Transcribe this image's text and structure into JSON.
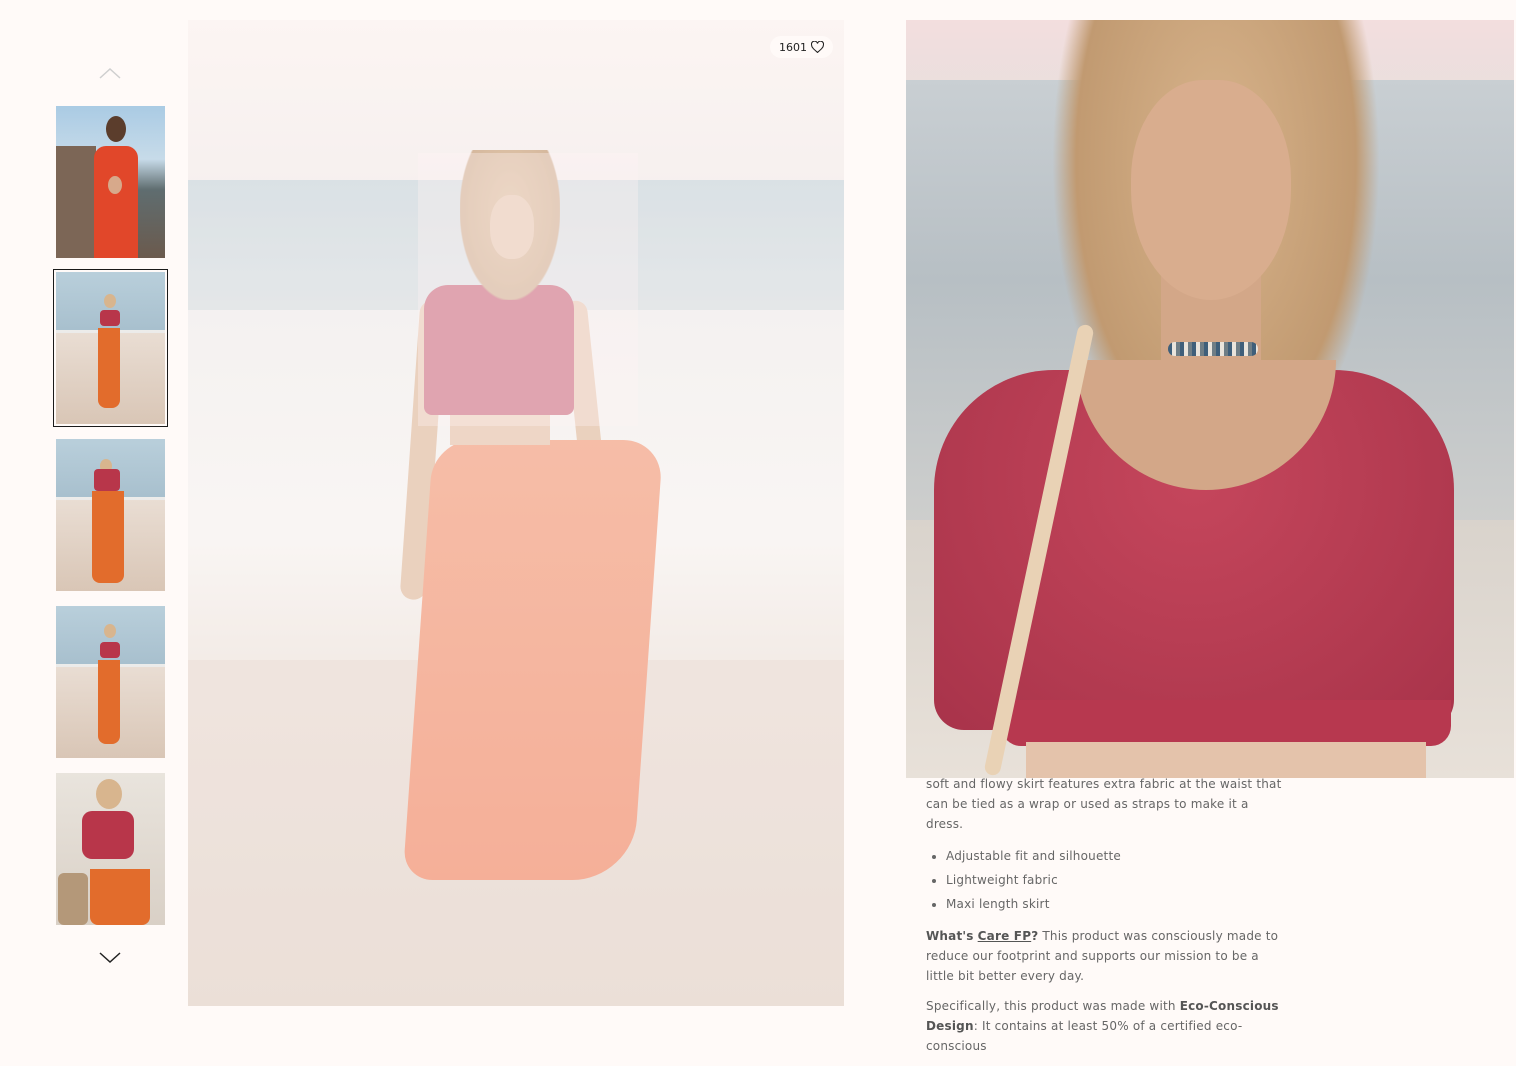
{
  "gallery": {
    "prev_label": "Previous image",
    "next_label": "Next image",
    "thumbnails": [
      {
        "alt": "Model in red halter dress on rocks",
        "selected": false
      },
      {
        "alt": "Model walking on beach in red top and orange skirt",
        "selected": true
      },
      {
        "alt": "Model from back on beach",
        "selected": false
      },
      {
        "alt": "Model walking in surf",
        "selected": false
      },
      {
        "alt": "Model close-up holding bag",
        "selected": false
      }
    ]
  },
  "main_image": {
    "like_count": "1601",
    "like_icon": "heart-outline-icon"
  },
  "description": {
    "intro_tail": "soft and flowy skirt features extra fabric at the waist that can be tied as a wrap or used as straps to make it a dress.",
    "features": [
      "Adjustable fit and silhouette",
      "Lightweight fabric",
      "Maxi length skirt"
    ],
    "care_prefix": "What's",
    "care_link": "Care FP",
    "care_suffix": "?",
    "care_text": "This product was consciously made to reduce our footprint and supports our mission to be a little bit better every day.",
    "eco_prefix": "Specifically, this product was made with",
    "eco_bold": "Eco-Conscious Design",
    "eco_text": ": It contains at least 50% of a certified eco-conscious"
  },
  "colors": {
    "page_bg": "#fffaf8",
    "top_red": "#b8405a",
    "skirt_orange": "#f08d6b"
  }
}
